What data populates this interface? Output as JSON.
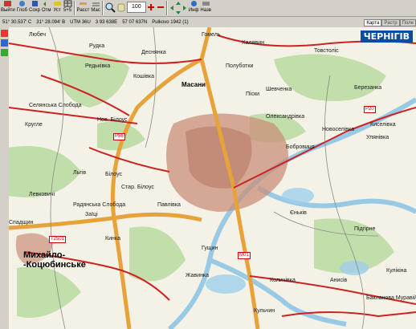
{
  "toolbar": {
    "buttons": [
      {
        "label": "Выйти",
        "icon": "exit-icon"
      },
      {
        "label": "Глоб",
        "icon": "globe-icon"
      },
      {
        "label": "Сохр",
        "icon": "save-icon"
      },
      {
        "label": "Отм",
        "icon": "undo-icon"
      },
      {
        "label": "Уст",
        "icon": "set-icon"
      },
      {
        "label": "5+5",
        "icon": "grid-icon"
      },
      {
        "label": "Расст",
        "icon": "ruler-icon"
      },
      {
        "label": "Мас",
        "icon": "scale-icon"
      },
      {
        "label": "Инф",
        "icon": "info-icon"
      },
      {
        "label": "Назв",
        "icon": "name-icon"
      }
    ],
    "zoom_value": "100"
  },
  "status": {
    "lat": "51° 30.537' С",
    "lon": "31° 28.094' В",
    "utm": "UTM 36U",
    "easting": "3 93 638E",
    "northing": "57 07 637N",
    "datum": "Pulkovo 1942 (1)"
  },
  "tabs": [
    "Карта",
    "Растр",
    "Поле"
  ],
  "map": {
    "title": "ЧЕРНІГІВ",
    "labels": [
      {
        "text": "Любеч"
      },
      {
        "text": "Гомель"
      },
      {
        "text": "Халявин"
      },
      {
        "text": "Рудка"
      },
      {
        "text": "Деснянка"
      },
      {
        "text": "Товстоліс"
      },
      {
        "text": "Редьківка"
      },
      {
        "text": "Кошівка"
      },
      {
        "text": "Полуботки"
      },
      {
        "text": "Березанка"
      },
      {
        "text": "Масани"
      },
      {
        "text": "Піски"
      },
      {
        "text": "Шевченка"
      },
      {
        "text": "Селянська Слобода"
      },
      {
        "text": "Олександрівка"
      },
      {
        "text": "Нов. Білоус"
      },
      {
        "text": "Новоселівка"
      },
      {
        "text": "Кругле"
      },
      {
        "text": "Льгів"
      },
      {
        "text": "Киселівка"
      },
      {
        "text": "Улянівка"
      },
      {
        "text": "Бобровиця"
      },
      {
        "text": "Левковичі"
      },
      {
        "text": "Білоус"
      },
      {
        "text": "Стар. Білоус"
      },
      {
        "text": "Радянська Слобода"
      },
      {
        "text": "Заїці"
      },
      {
        "text": "Павлівка"
      },
      {
        "text": "Єньків"
      },
      {
        "text": "Підгірне"
      },
      {
        "text": "Гущин"
      },
      {
        "text": "Кинка"
      },
      {
        "text": "Жавинка"
      },
      {
        "text": "Анисів"
      },
      {
        "text": "Количівка"
      },
      {
        "text": "Бакланова Муравійка"
      },
      {
        "text": "Кульчин"
      },
      {
        "text": "Спадщин"
      },
      {
        "text": "Кулікіна"
      }
    ],
    "big_label": "Михайло-\n-Коцюбинське",
    "roads": [
      "М01",
      "Р56",
      "Р20",
      "Т2501",
      "М01"
    ]
  },
  "colors": {
    "map_bg": "#f4f2e6",
    "road_main": "#e8a23a",
    "road_red": "#cc2222",
    "water": "#8fc6e6",
    "forest": "#b9d9a2",
    "urban": "#c98f7a",
    "brand": "#0a4d9e"
  }
}
